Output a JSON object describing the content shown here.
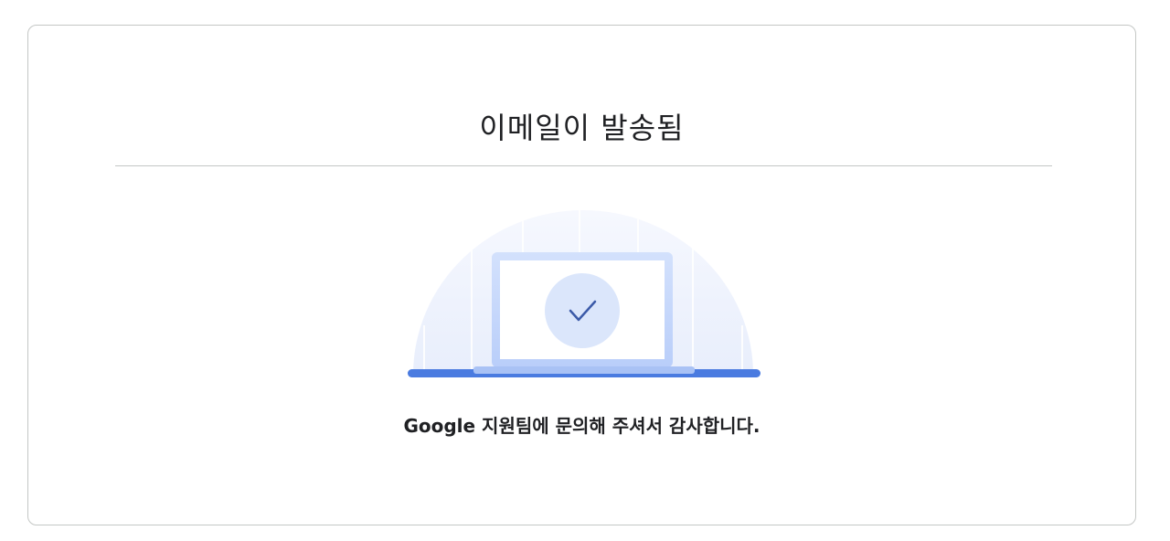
{
  "dialog": {
    "title": "이메일이 발송됨",
    "message": "Google 지원팀에 문의해 주셔서 감사합니다."
  },
  "illustration": {
    "icons": [
      "laptop-icon",
      "checkmark-icon"
    ],
    "colors": {
      "accent": "#4a7be0",
      "screen_frame": "#c7d8fb",
      "check_circle": "#dbe6fb",
      "check_mark": "#3b5aa8",
      "dome": "#f3f6fd"
    }
  }
}
